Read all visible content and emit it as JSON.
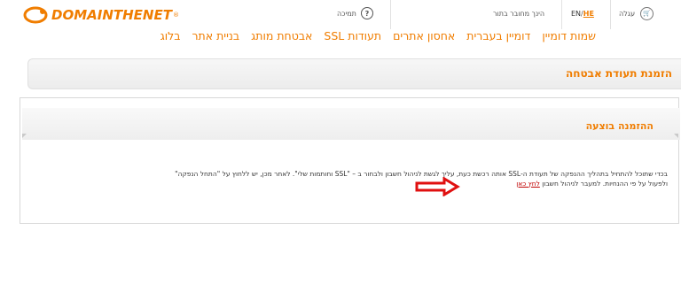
{
  "logo": {
    "text": "DOMAINTHENET",
    "reg": "®"
  },
  "topbar": {
    "cart_label": "עגלה",
    "lang_en": "EN",
    "lang_sep": " / ",
    "lang_he": "HE",
    "login_text": "הינך מחובר בתור",
    "support_label": "תמיכה"
  },
  "nav": {
    "items": [
      "שמות דומיין",
      "דומיין בעברית",
      "אחסון אתרים",
      "תעודות SSL",
      "אבטחת מותג",
      "בניית אתר",
      "בלוג"
    ]
  },
  "page": {
    "title": "הזמנת תעודת אבטחה"
  },
  "panel": {
    "title": "ההזמנה בוצעה",
    "message_line1": "בכדי שתוכל להתחיל בתהליך ההנפקה של תעודת ה-SSL אותה רכשת כעת, עליך לגשת לניהול חשבון ולבחור ב – \"SSL וחותמות שלי\". לאחר מכן, יש ללחוץ על \"התחל הנפקה\"",
    "message_line2": "ולפעול על פי ההנחיות. למעבר לניהול חשבון ",
    "link_text": "לחץ כאן"
  },
  "colors": {
    "accent": "#f07d00",
    "link": "#c00000",
    "arrow": "#e01010"
  }
}
